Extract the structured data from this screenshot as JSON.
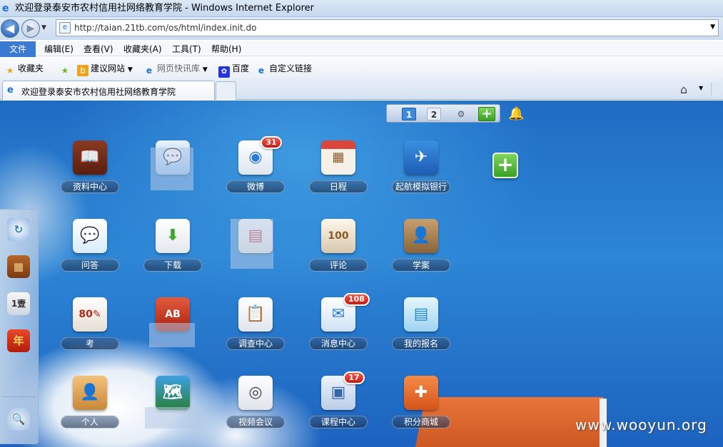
{
  "window": {
    "title": "欢迎登录泰安市农村信用社网络教育学院 - Windows Internet Explorer"
  },
  "address": {
    "url": "http://taian.21tb.com/os/html/index.init.do"
  },
  "menu": [
    "文件(F)",
    "编辑(E)",
    "查看(V)",
    "收藏夹(A)",
    "工具(T)",
    "帮助(H)"
  ],
  "favorites": {
    "favorites_label": "收藏夹",
    "items": [
      "建议网站",
      "网页快讯库",
      "百度",
      "自定义链接"
    ]
  },
  "tab": {
    "title": "欢迎登录泰安市农村信用社网络教育学院"
  },
  "desktop": {
    "pages": [
      "1",
      "2"
    ],
    "current_page": "1",
    "apps": [
      {
        "label": "资料中心",
        "icon": "book-icon",
        "badge": ""
      },
      {
        "label": "",
        "icon": "chat-bubble-icon",
        "badge": ""
      },
      {
        "label": "微博",
        "icon": "microblog-icon",
        "badge": "31"
      },
      {
        "label": "日程",
        "icon": "calendar-icon",
        "badge": ""
      },
      {
        "label": "起航模拟银行",
        "icon": "bank-sim-icon",
        "badge": ""
      },
      {
        "label": "问答",
        "icon": "qa-icon",
        "badge": ""
      },
      {
        "label": "下载",
        "icon": "download-icon",
        "badge": ""
      },
      {
        "label": "",
        "icon": "document-icon",
        "badge": ""
      },
      {
        "label": "评论",
        "icon": "notes-icon",
        "badge": ""
      },
      {
        "label": "学案",
        "icon": "profile-card-icon",
        "badge": ""
      },
      {
        "label": "考",
        "icon": "exam-icon",
        "badge": ""
      },
      {
        "label": "",
        "icon": "abc-book-icon",
        "badge": ""
      },
      {
        "label": "调查中心",
        "icon": "clipboard-icon",
        "badge": ""
      },
      {
        "label": "消息中心",
        "icon": "mail-icon",
        "badge": "108"
      },
      {
        "label": "我的报名",
        "icon": "signup-icon",
        "badge": ""
      },
      {
        "label": "个人",
        "icon": "contact-icon",
        "badge": ""
      },
      {
        "label": "",
        "icon": "map-icon",
        "badge": ""
      },
      {
        "label": "视频会议",
        "icon": "webcam-icon",
        "badge": ""
      },
      {
        "label": "课程中心",
        "icon": "course-icon",
        "badge": "17"
      },
      {
        "label": "积分商城",
        "icon": "points-mall-icon",
        "badge": ""
      }
    ]
  },
  "dock": [
    "refresh-icon",
    "abacus-icon",
    "counter-icon",
    "calendar-year-icon",
    "search-icon"
  ],
  "watermark": "www.wooyun.org",
  "colors": {
    "accent": "#3a7ad0",
    "desktop_blue": "#2478cf",
    "badge_red": "#d92a1c",
    "add_green": "#46a82b",
    "roof_orange": "#e06a32"
  }
}
